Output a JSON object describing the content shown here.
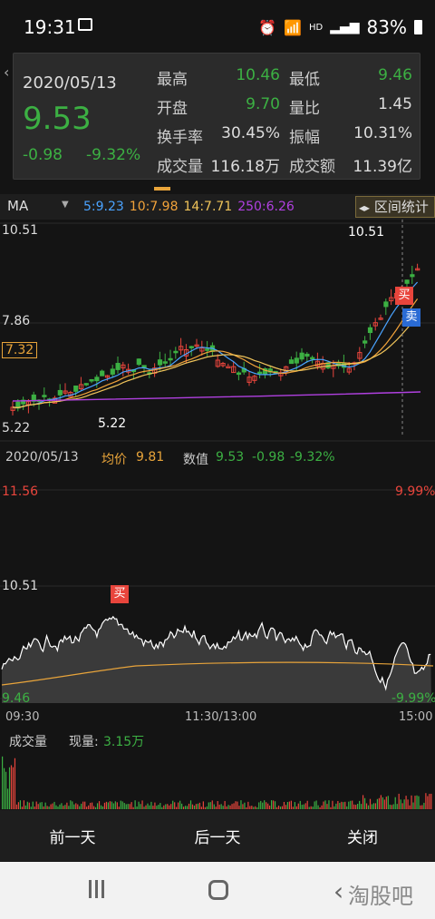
{
  "status": {
    "time": "19:31",
    "battery": "83%",
    "hd": "HD"
  },
  "popup": {
    "date": "2020/05/13",
    "price": "9.53",
    "change": "-0.98",
    "change_pct": "-9.32%",
    "rows": [
      {
        "l1": "最高",
        "v1": "10.46",
        "c1": "#3cb043",
        "l2": "最低",
        "v2": "9.46",
        "c2": "#3cb043"
      },
      {
        "l1": "开盘",
        "v1": "9.70",
        "c1": "#3cb043",
        "l2": "量比",
        "v2": "1.45",
        "c2": "#ddd"
      },
      {
        "l1": "换手率",
        "v1": "30.45%",
        "c1": "#ddd",
        "l2": "振幅",
        "v2": "10.31%",
        "c2": "#ddd"
      },
      {
        "l1": "成交量",
        "v1": "116.18万",
        "c1": "#ddd",
        "l2": "成交额",
        "v2": "11.39亿",
        "c2": "#ddd"
      }
    ]
  },
  "ma_bar": {
    "select": "MA",
    "ma5": "5:9.23",
    "ma10": "10:7.98",
    "ma14": "14:7.71",
    "ma250": "250:6.26",
    "range_label": "区间统计"
  },
  "kline": {
    "y_top": "10.51",
    "y_mid": "7.86",
    "y_marker": "7.32",
    "y_bottom": "5.22",
    "low_annot": "5.22",
    "high_annot": "10.51",
    "buy": "买",
    "sell": "卖"
  },
  "info_row": {
    "date": "2020/05/13",
    "avg_label": "均价",
    "avg_val": "9.81",
    "num_label": "数值",
    "num_val": "9.53",
    "num_chg": "-0.98",
    "num_pct": "-9.32%"
  },
  "intraday": {
    "y_top": "11.56",
    "y_top_pct": "9.99%",
    "y_mid": "10.51",
    "y_bottom": "9.46",
    "y_bottom_pct": "-9.99%",
    "buy": "买"
  },
  "time_axis": [
    "09:30",
    "11:30/13:00",
    "15:00"
  ],
  "volume": {
    "label": "成交量",
    "now_label": "现量:",
    "now_val": "3.15万"
  },
  "bottom": {
    "prev": "前一天",
    "next": "后一天",
    "close": "关闭"
  },
  "watermark": "淘股吧",
  "colors": {
    "up": "#e8453c",
    "down": "#3cb043",
    "ma5": "#4aa3ff",
    "ma10": "#f2a33a",
    "ma14": "#f0c45a",
    "ma250": "#b040e0"
  }
}
